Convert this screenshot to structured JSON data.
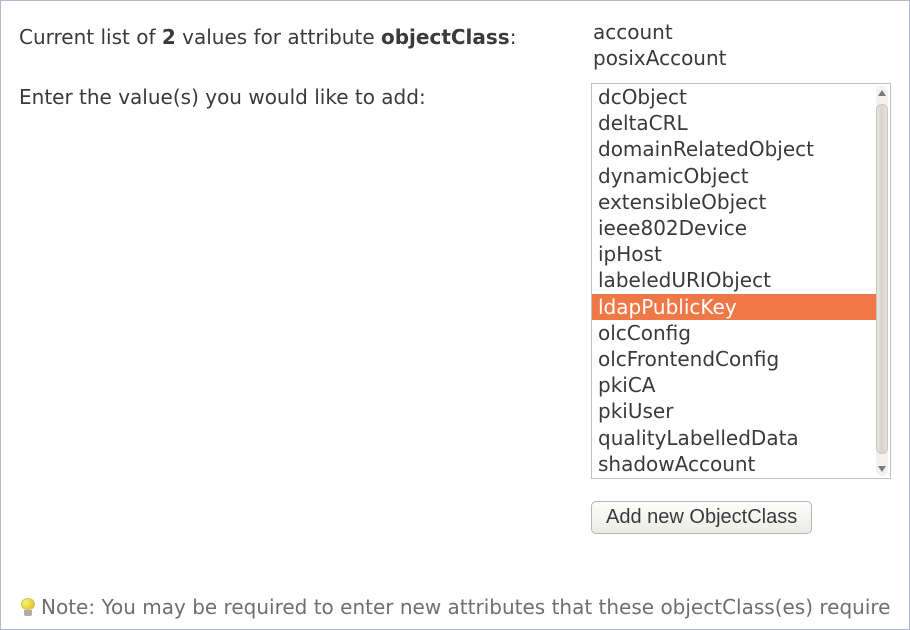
{
  "left": {
    "current_values_prefix": "Current list of ",
    "count": "2",
    "current_values_mid": " values for attribute ",
    "attribute_name": "objectClass",
    "current_values_suffix": ":",
    "enter_values": "Enter the value(s) you would like to add:"
  },
  "current_values": [
    "account",
    "posixAccount"
  ],
  "listbox": {
    "items": [
      "dcObject",
      "deltaCRL",
      "domainRelatedObject",
      "dynamicObject",
      "extensibleObject",
      "ieee802Device",
      "ipHost",
      "labeledURIObject",
      "ldapPublicKey",
      "olcConfig",
      "olcFrontendConfig",
      "pkiCA",
      "pkiUser",
      "qualityLabelledData",
      "shadowAccount"
    ],
    "selected": "ldapPublicKey"
  },
  "buttons": {
    "add": "Add new ObjectClass"
  },
  "note": "Note: You may be required to enter new attributes that these objectClass(es) require"
}
